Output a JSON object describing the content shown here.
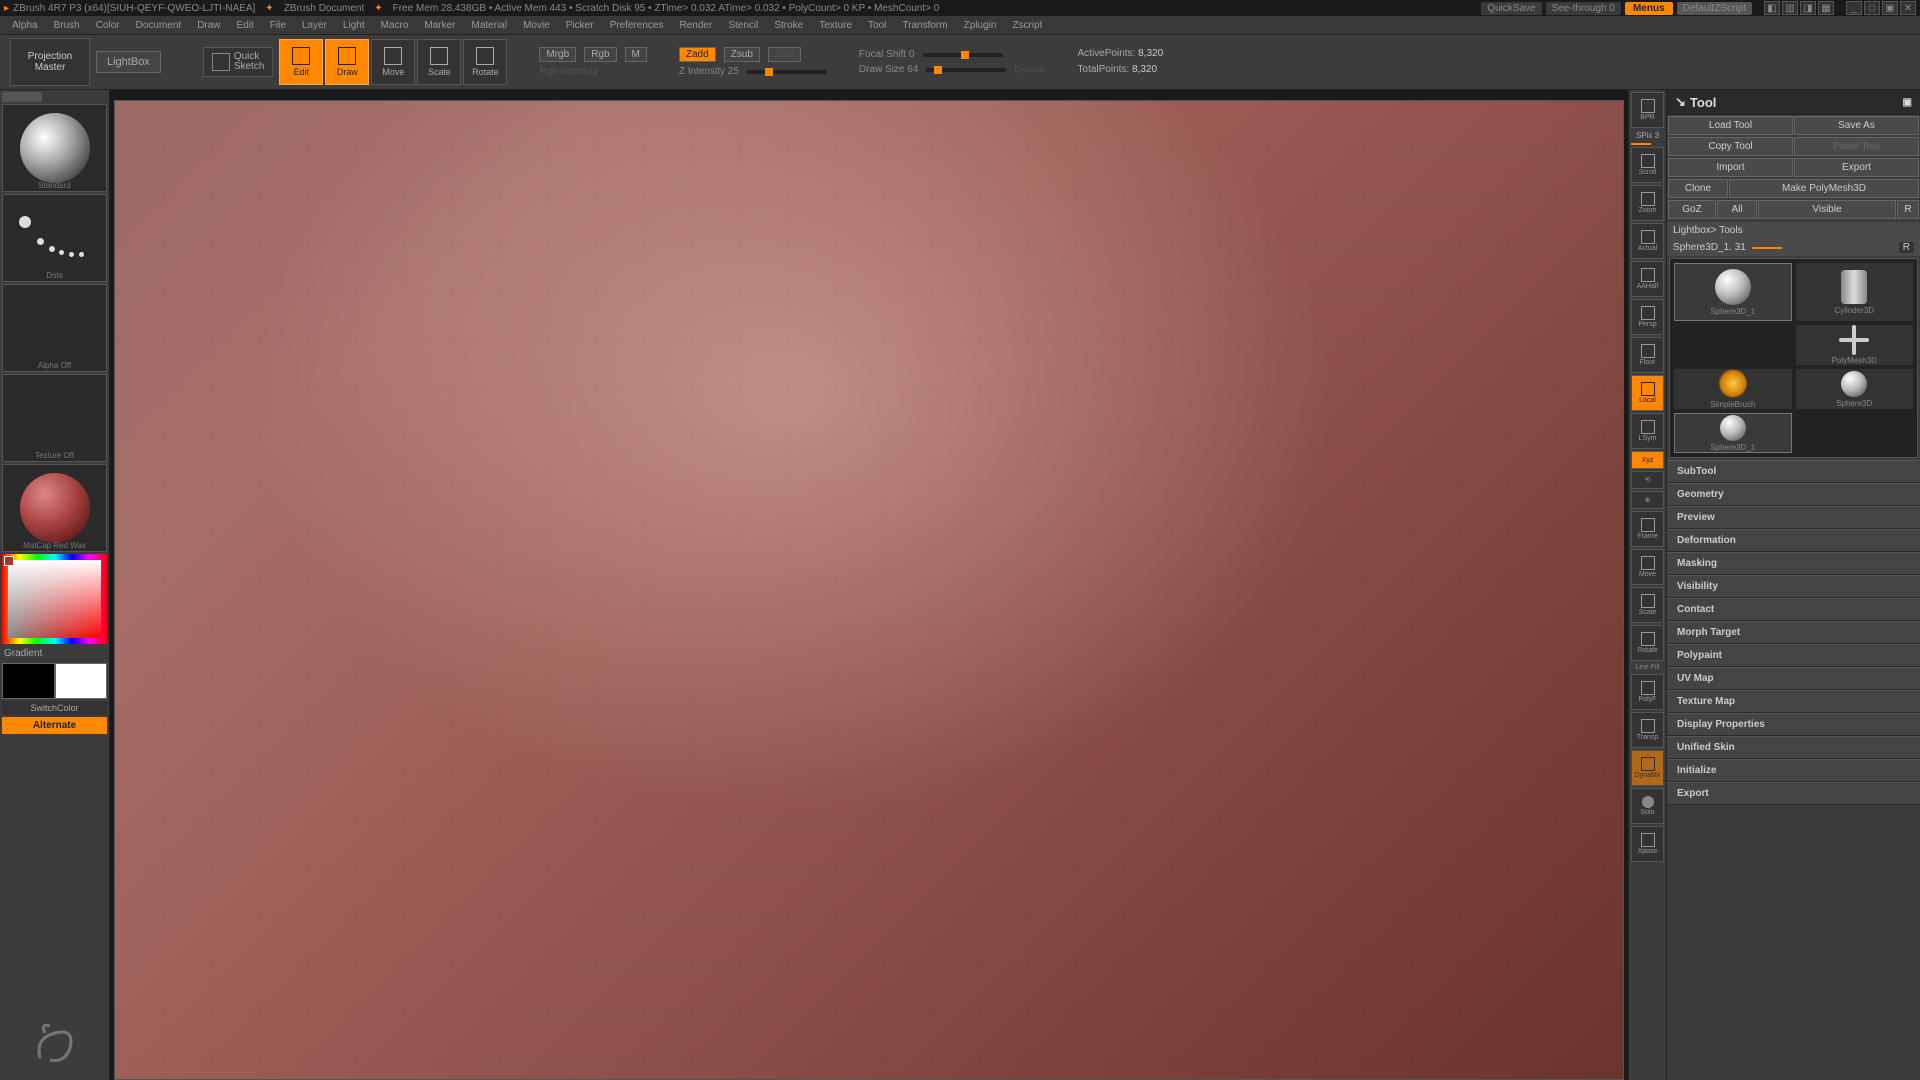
{
  "title": {
    "app": "ZBrush 4R7 P3 (x64)[SIUH-QEYF-QWEO-LJTI-NAEA]",
    "doc": "ZBrush Document",
    "stats": "Free Mem 28.438GB • Active Mem 443 • Scratch Disk 95 • ZTime> 0.032 ATime> 0.032 • PolyCount> 0 KP • MeshCount> 0",
    "quicksave": "QuickSave",
    "seethrough": "See-through  0",
    "menus": "Menus",
    "script": "DefaultZScript"
  },
  "menu": [
    "Alpha",
    "Brush",
    "Color",
    "Document",
    "Draw",
    "Edit",
    "File",
    "Layer",
    "Light",
    "Macro",
    "Marker",
    "Material",
    "Movie",
    "Picker",
    "Preferences",
    "Render",
    "Stencil",
    "Stroke",
    "Texture",
    "Tool",
    "Transform",
    "Zplugin",
    "Zscript"
  ],
  "toolbar": {
    "projection": "Projection\nMaster",
    "lightbox": "LightBox",
    "quicksketch": "Quick\nSketch",
    "modes": {
      "edit": "Edit",
      "draw": "Draw",
      "move": "Move",
      "scale": "Scale",
      "rotate": "Rotate"
    },
    "mrgb": "Mrgb",
    "rgb": "Rgb",
    "m": "M",
    "rgbint": "Rgb Intensity",
    "zadd": "Zadd",
    "zsub": "Zsub",
    "zcut": "Zcut",
    "zint": "Z Intensity 25",
    "focal": "Focal Shift 0",
    "drawsize": "Draw Size 64",
    "dynamic": "Dynamic",
    "active": "ActivePoints:",
    "activev": "8,320",
    "total": "TotalPoints:",
    "totalv": "8,320"
  },
  "left": {
    "brush": "Standard",
    "stroke": "Dots",
    "alpha": "Alpha Off",
    "texture": "Texture Off",
    "material": "MatCap Red Wax",
    "gradient": "Gradient",
    "switch": "SwitchColor",
    "alternate": "Alternate"
  },
  "nav": [
    "BPR",
    "Scroll",
    "Zoom",
    "Actual",
    "AAHalf",
    "Persp",
    "Floor",
    "Local",
    "LSym",
    "Xyz",
    "",
    "",
    "Frame",
    "Move",
    "Scale",
    "Rotate",
    "Line Fill",
    "PolyF",
    "Transp",
    "DynaMx",
    "Solo",
    "Xpose"
  ],
  "nav_extra": {
    "spix": "SPix 3"
  },
  "right": {
    "title": "Tool",
    "row1": {
      "load": "Load Tool",
      "save": "Save As"
    },
    "row2": {
      "copy": "Copy Tool",
      "paste": "Paste Tool"
    },
    "row3": {
      "import": "Import",
      "export": "Export"
    },
    "row4": {
      "clone": "Clone",
      "make": "Make PolyMesh3D"
    },
    "row5": {
      "goz": "GoZ",
      "all": "All",
      "visible": "Visible",
      "r": "R"
    },
    "lightboxtools": "Lightbox> Tools",
    "curtool": "Sphere3D_1. 31",
    "items": {
      "sphere": "Sphere3D_1",
      "cyl": "Cylinder3D",
      "poly": "PolyMesh3D",
      "simple": "SimpleBrush",
      "sphere2": "Sphere3D",
      "sphere3": "Sphere3D_1"
    },
    "palettes": [
      "SubTool",
      "Geometry",
      "Preview",
      "Deformation",
      "Masking",
      "Visibility",
      "Contact",
      "Morph Target",
      "Polypaint",
      "UV Map",
      "Texture Map",
      "Display Properties",
      "Unified Skin",
      "Initialize",
      "Export"
    ]
  }
}
